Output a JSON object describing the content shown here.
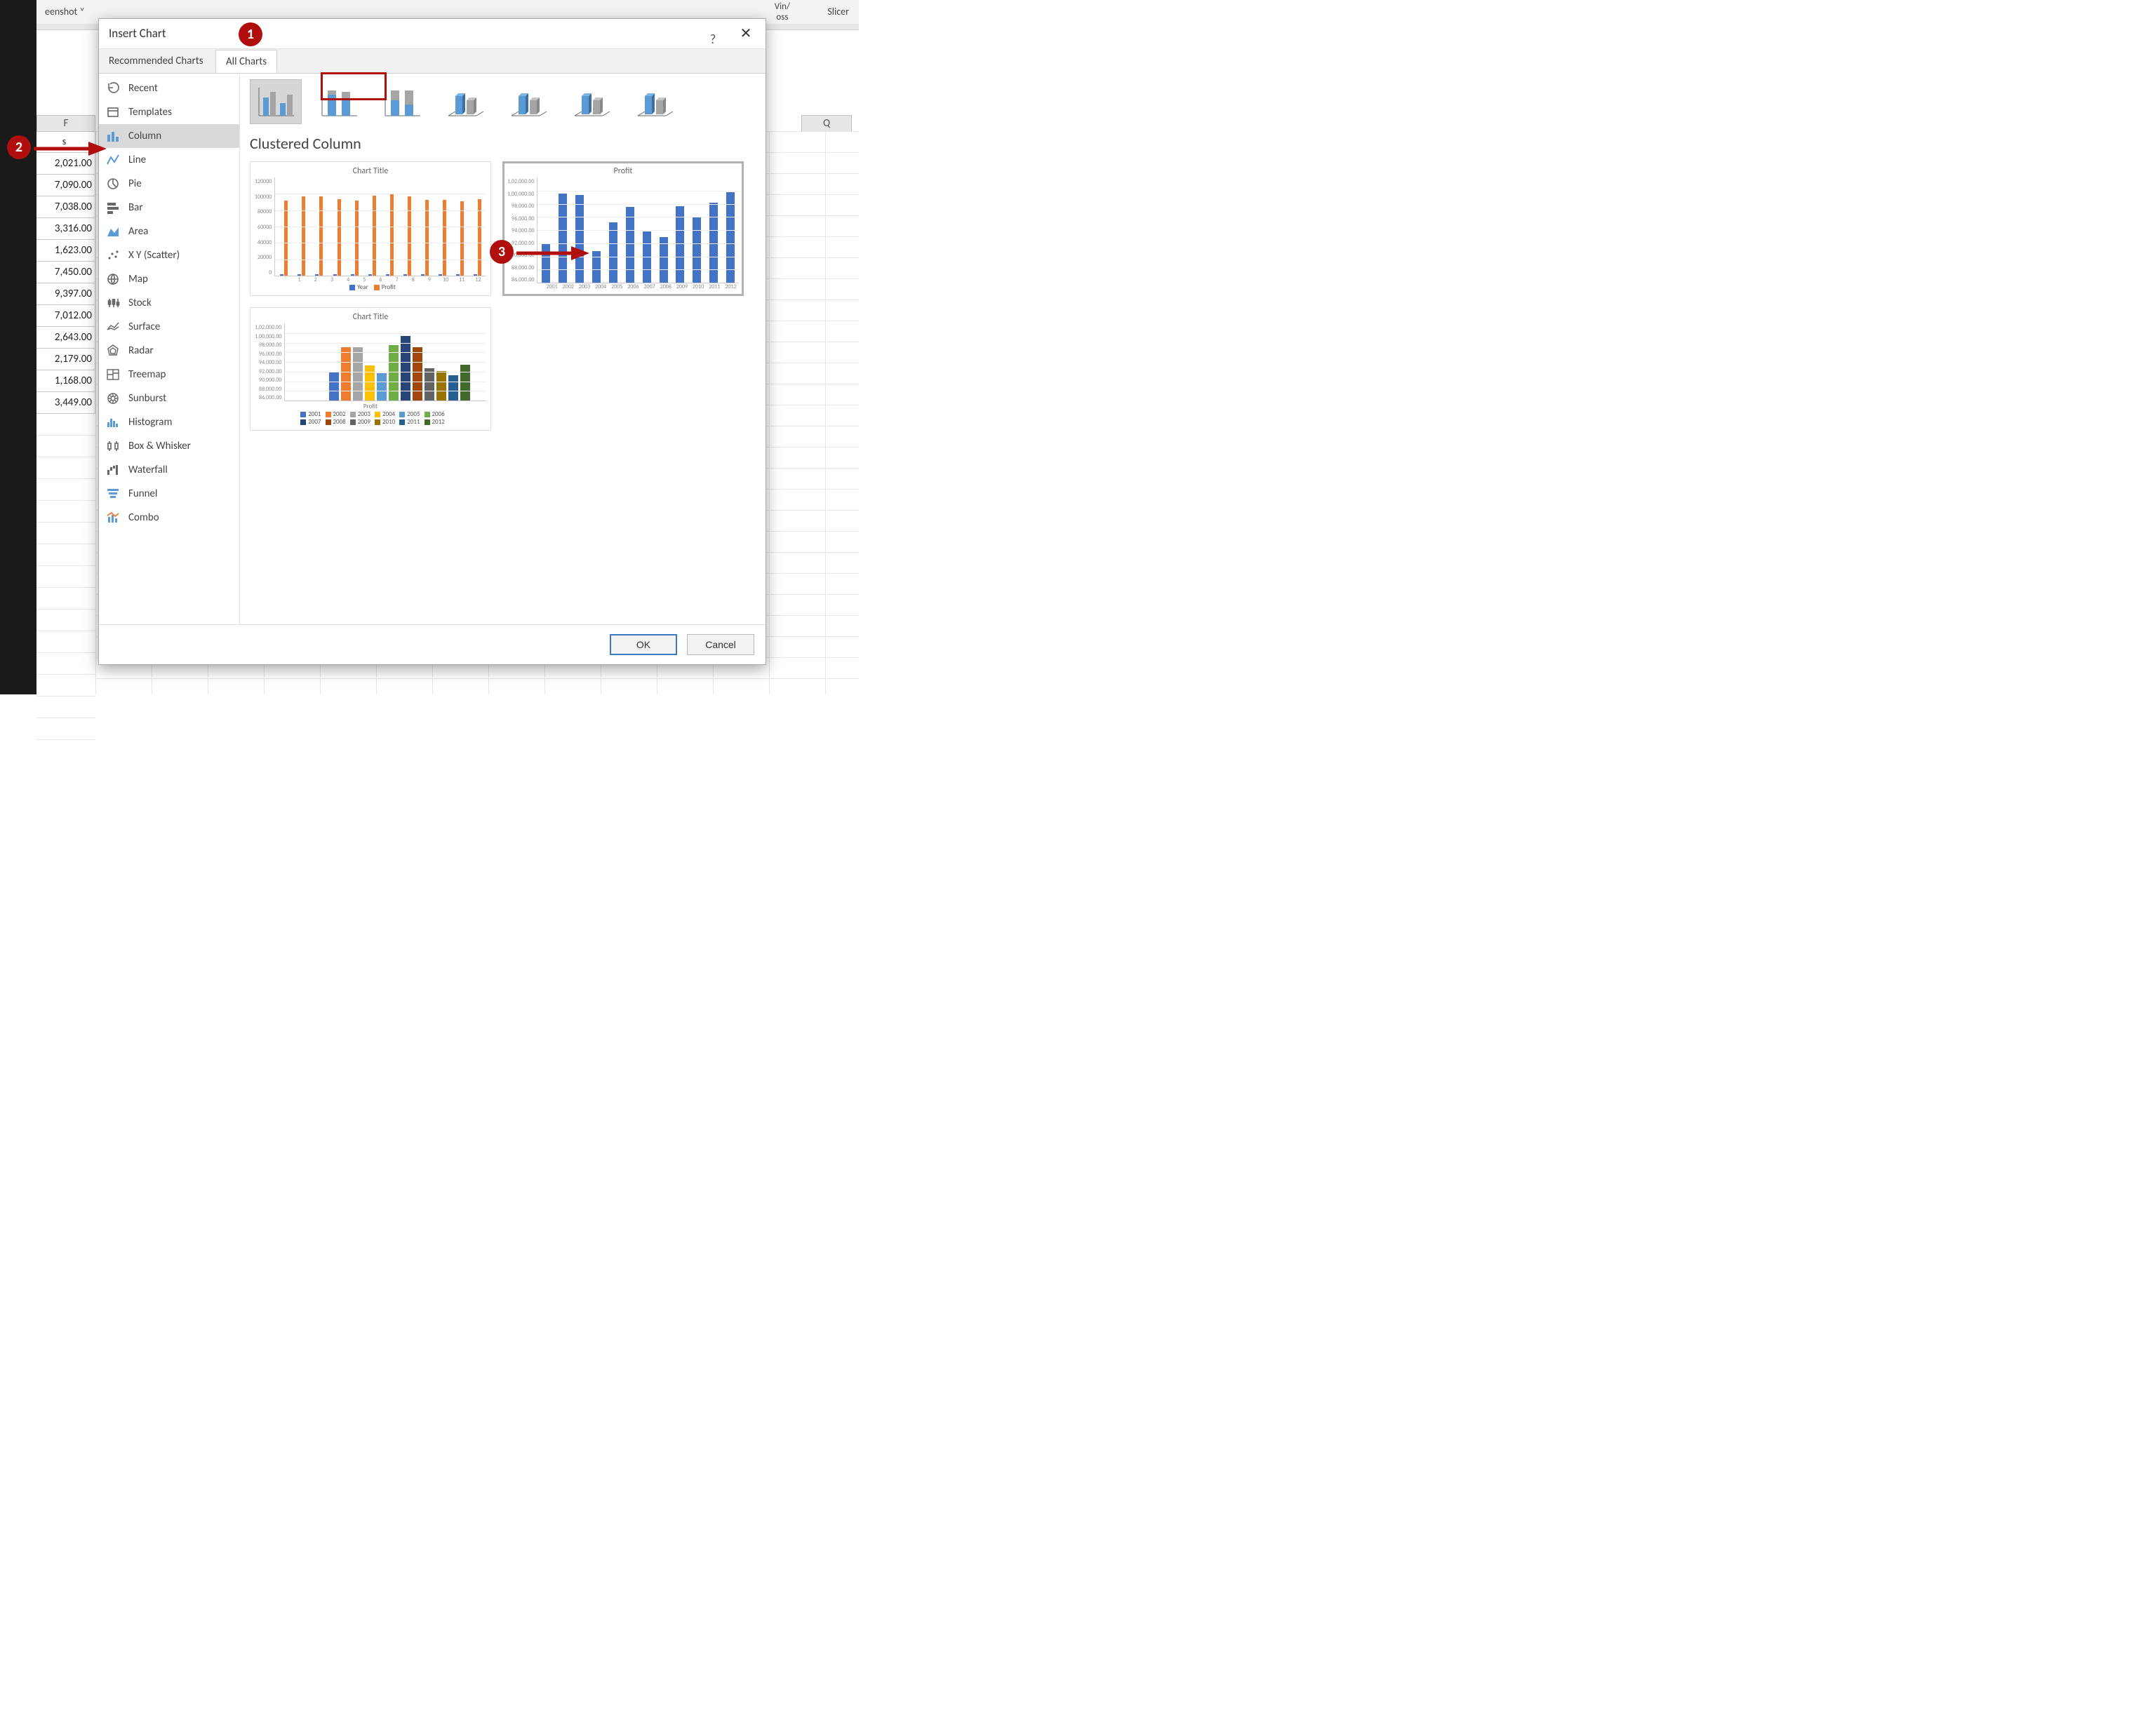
{
  "ribbon": {
    "screenshot_label": "eenshot ˅",
    "winloss_top": "Vin/",
    "winloss_bot": "oss",
    "slicer_label": "Slicer"
  },
  "sheet": {
    "col_f": "F",
    "col_q": "Q",
    "s_label": "s",
    "values": [
      "2,021.00",
      "7,090.00",
      "7,038.00",
      "3,316.00",
      "1,623.00",
      "7,450.00",
      "9,397.00",
      "7,012.00",
      "2,643.00",
      "2,179.00",
      "1,168.00",
      "3,449.00"
    ]
  },
  "dialog": {
    "title": "Insert Chart",
    "tab_recommended": "Recommended Charts",
    "tab_all": "All Charts",
    "ok": "OK",
    "cancel": "Cancel"
  },
  "sidebar": {
    "items": [
      {
        "label": "Recent"
      },
      {
        "label": "Templates"
      },
      {
        "label": "Column"
      },
      {
        "label": "Line"
      },
      {
        "label": "Pie"
      },
      {
        "label": "Bar"
      },
      {
        "label": "Area"
      },
      {
        "label": "X Y (Scatter)"
      },
      {
        "label": "Map"
      },
      {
        "label": "Stock"
      },
      {
        "label": "Surface"
      },
      {
        "label": "Radar"
      },
      {
        "label": "Treemap"
      },
      {
        "label": "Sunburst"
      },
      {
        "label": "Histogram"
      },
      {
        "label": "Box & Whisker"
      },
      {
        "label": "Waterfall"
      },
      {
        "label": "Funnel"
      },
      {
        "label": "Combo"
      }
    ]
  },
  "content": {
    "subtitle": "Clustered Column",
    "preview1_title": "Chart Title",
    "preview2_title": "Profit",
    "preview3_title": "Chart Title",
    "preview3_axis_title": "Profit",
    "legend1_year": "Year",
    "legend1_profit": "Profit"
  },
  "chart_data": [
    {
      "name": "preview1",
      "type": "bar",
      "categories": [
        "1",
        "2",
        "3",
        "4",
        "5",
        "6",
        "7",
        "8",
        "9",
        "10",
        "11",
        "12"
      ],
      "series": [
        {
          "name": "Year",
          "color": "#4472c4",
          "values": [
            2001,
            2002,
            2003,
            2004,
            2005,
            2006,
            2007,
            2008,
            2009,
            2010,
            2011,
            2012
          ]
        },
        {
          "name": "Profit",
          "color": "#ed7d31",
          "values": [
            92021,
            97090,
            97038,
            93316,
            91623,
            97450,
            99397,
            97012,
            92643,
            92179,
            91168,
            93449
          ]
        }
      ],
      "ylim": [
        0,
        120000
      ],
      "yticks": [
        0,
        20000,
        40000,
        60000,
        80000,
        100000,
        120000
      ],
      "title": "Chart Title"
    },
    {
      "name": "preview2",
      "type": "bar",
      "categories": [
        "2001",
        "2002",
        "2003",
        "2004",
        "2005",
        "2006",
        "2007",
        "2008",
        "2009",
        "2010",
        "2011",
        "2012"
      ],
      "series": [
        {
          "name": "Profit",
          "color": "#4472c4",
          "values": [
            92000,
            99500,
            99300,
            90800,
            95200,
            97500,
            93800,
            92900,
            97600,
            96000,
            98200,
            99800
          ]
        }
      ],
      "ylim": [
        86000,
        102000
      ],
      "yticks": [
        "86,000.00",
        "88,000.00",
        "90,000.00",
        "92,000.00",
        "94,000.00",
        "96,000.00",
        "98,000.00",
        "1,00,000.00",
        "1,02,000.00"
      ],
      "title": "Profit"
    },
    {
      "name": "preview3",
      "type": "bar",
      "categories": [
        "2001",
        "2002",
        "2003",
        "2004",
        "2005",
        "2006",
        "2007",
        "2008",
        "2009",
        "2010",
        "2011",
        "2012"
      ],
      "series": [
        {
          "name": "2001",
          "color": "#4472c4",
          "values": [
            92021
          ]
        },
        {
          "name": "2002",
          "color": "#ed7d31",
          "values": [
            97090
          ]
        },
        {
          "name": "2003",
          "color": "#a5a5a5",
          "values": [
            97038
          ]
        },
        {
          "name": "2004",
          "color": "#ffc000",
          "values": [
            93316
          ]
        },
        {
          "name": "2005",
          "color": "#5b9bd5",
          "values": [
            91623
          ]
        },
        {
          "name": "2006",
          "color": "#70ad47",
          "values": [
            97450
          ]
        },
        {
          "name": "2007",
          "color": "#264478",
          "values": [
            99397
          ]
        },
        {
          "name": "2008",
          "color": "#9e480e",
          "values": [
            97012
          ]
        },
        {
          "name": "2009",
          "color": "#636363",
          "values": [
            92643
          ]
        },
        {
          "name": "2010",
          "color": "#997300",
          "values": [
            92179
          ]
        },
        {
          "name": "2011",
          "color": "#255e91",
          "values": [
            91168
          ]
        },
        {
          "name": "2012",
          "color": "#43682b",
          "values": [
            93449
          ]
        }
      ],
      "legend_rows": [
        [
          {
            "name": "2001",
            "color": "#4472c4"
          },
          {
            "name": "2002",
            "color": "#ed7d31"
          },
          {
            "name": "2003",
            "color": "#a5a5a5"
          },
          {
            "name": "2004",
            "color": "#ffc000"
          },
          {
            "name": "2005",
            "color": "#5b9bd5"
          },
          {
            "name": "2006",
            "color": "#70ad47"
          }
        ],
        [
          {
            "name": "2007",
            "color": "#264478"
          },
          {
            "name": "2008",
            "color": "#9e480e"
          },
          {
            "name": "2009",
            "color": "#636363"
          },
          {
            "name": "2010",
            "color": "#997300"
          },
          {
            "name": "2011",
            "color": "#255e91"
          },
          {
            "name": "2012",
            "color": "#43682b"
          }
        ]
      ],
      "ylim": [
        86000,
        102000
      ],
      "yticks": [
        "86,000.00",
        "88,000.00",
        "90,000.00",
        "92,000.00",
        "94,000.00",
        "96,000.00",
        "98,000.00",
        "1,00,000.00",
        "1,02,000.00"
      ],
      "title": "Chart Title",
      "axis_title": "Profit"
    }
  ],
  "annotations": {
    "c1": "1",
    "c2": "2",
    "c3": "3"
  }
}
